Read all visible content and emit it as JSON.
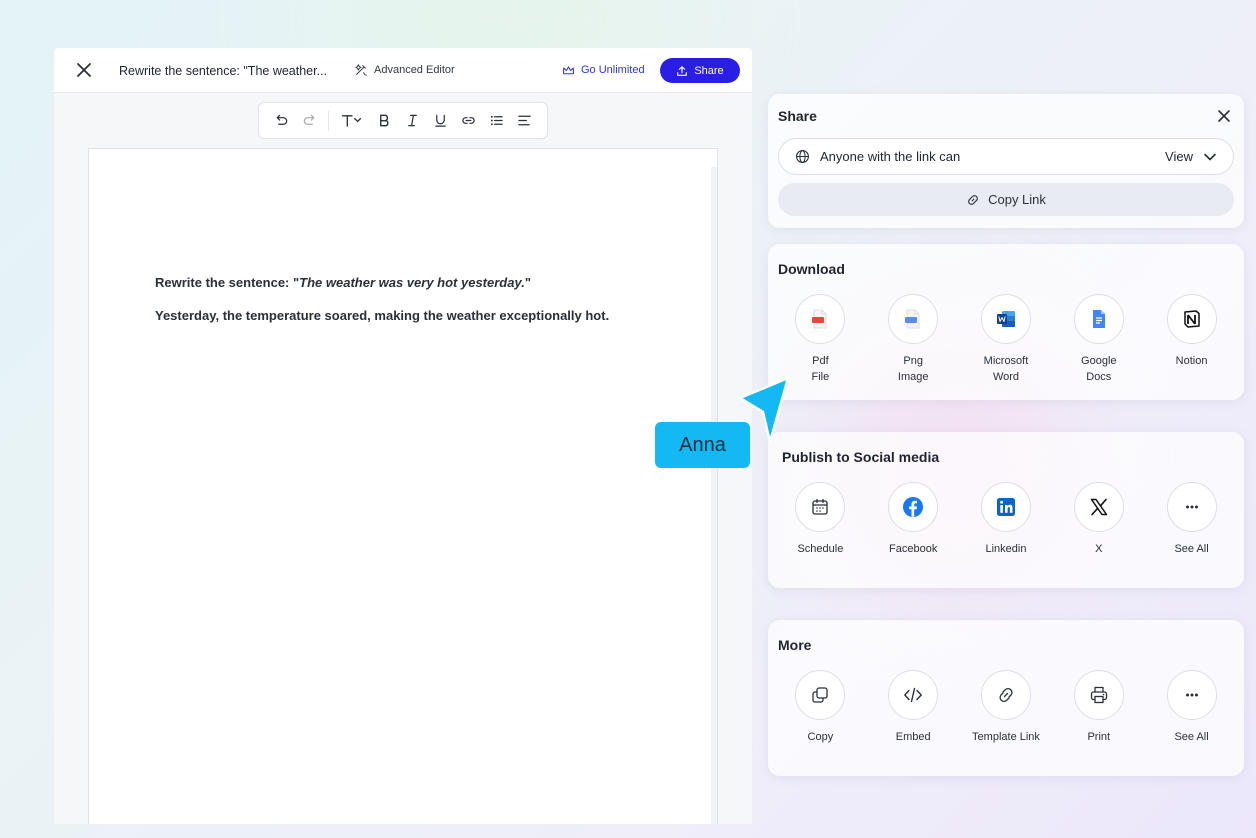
{
  "editor": {
    "doc_title": "Rewrite the sentence: \"The weather...",
    "advanced_editor_label": "Advanced Editor",
    "go_unlimited_label": "Go Unlimited",
    "share_label": "Share",
    "content": {
      "question_prefix": "Rewrite the sentence: \"",
      "question_italic": "The weather was very hot yesterday.",
      "question_suffix": "\"",
      "answer": "Yesterday, the temperature soared, making the weather exceptionally hot."
    }
  },
  "toolbar": {
    "buttons": [
      "undo-icon",
      "redo-icon",
      "text-style-icon",
      "bold-icon",
      "italic-icon",
      "underline-icon",
      "link-icon",
      "bullet-list-icon",
      "align-left-icon"
    ]
  },
  "share_panel": {
    "title": "Share",
    "access_text": "Anyone with the link can",
    "access_mode": "View",
    "copy_link_label": "Copy Link"
  },
  "download_panel": {
    "title": "Download",
    "items": [
      {
        "label": "Pdf\nFile",
        "icon": "pdf-file-icon"
      },
      {
        "label": "Png\nImage",
        "icon": "png-image-icon"
      },
      {
        "label": "Microsoft\nWord",
        "icon": "microsoft-word-icon"
      },
      {
        "label": "Google\nDocs",
        "icon": "google-docs-icon"
      },
      {
        "label": "Notion",
        "icon": "notion-icon"
      }
    ]
  },
  "social_panel": {
    "title": "Publish to Social media",
    "items": [
      {
        "label": "Schedule",
        "icon": "calendar-icon"
      },
      {
        "label": "Facebook",
        "icon": "facebook-icon"
      },
      {
        "label": "Linkedin",
        "icon": "linkedin-icon"
      },
      {
        "label": "X",
        "icon": "x-icon"
      },
      {
        "label": "See All",
        "icon": "more-dots-icon"
      }
    ]
  },
  "more_panel": {
    "title": "More",
    "items": [
      {
        "label": "Copy",
        "icon": "copy-icon"
      },
      {
        "label": "Embed",
        "icon": "embed-code-icon"
      },
      {
        "label": "Template Link",
        "icon": "link-icon"
      },
      {
        "label": "Print",
        "icon": "printer-icon"
      },
      {
        "label": "See All",
        "icon": "more-dots-icon"
      }
    ]
  },
  "cursor": {
    "name": "Anna",
    "color": "#14b9f3"
  },
  "colors": {
    "accent": "#2a1ee6",
    "link": "#3235d6"
  }
}
